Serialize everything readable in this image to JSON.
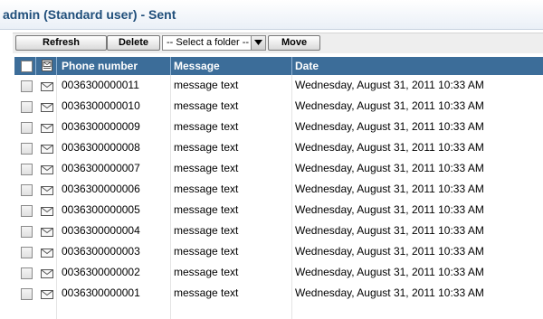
{
  "window": {
    "title": "admin (Standard user) - Sent"
  },
  "toolbar": {
    "refresh_label": "Refresh",
    "delete_label": "Delete",
    "folder_select_value": "-- Select a folder --",
    "move_label": "Move"
  },
  "table": {
    "columns": [
      "Phone number",
      "Message",
      "Date"
    ],
    "rows": [
      {
        "phone": "0036300000011",
        "message": "message text",
        "date": "Wednesday, August 31, 2011 10:33 AM"
      },
      {
        "phone": "0036300000010",
        "message": "message text",
        "date": "Wednesday, August 31, 2011 10:33 AM"
      },
      {
        "phone": "0036300000009",
        "message": "message text",
        "date": "Wednesday, August 31, 2011 10:33 AM"
      },
      {
        "phone": "0036300000008",
        "message": "message text",
        "date": "Wednesday, August 31, 2011 10:33 AM"
      },
      {
        "phone": "0036300000007",
        "message": "message text",
        "date": "Wednesday, August 31, 2011 10:33 AM"
      },
      {
        "phone": "0036300000006",
        "message": "message text",
        "date": "Wednesday, August 31, 2011 10:33 AM"
      },
      {
        "phone": "0036300000005",
        "message": "message text",
        "date": "Wednesday, August 31, 2011 10:33 AM"
      },
      {
        "phone": "0036300000004",
        "message": "message text",
        "date": "Wednesday, August 31, 2011 10:33 AM"
      },
      {
        "phone": "0036300000003",
        "message": "message text",
        "date": "Wednesday, August 31, 2011 10:33 AM"
      },
      {
        "phone": "0036300000002",
        "message": "message text",
        "date": "Wednesday, August 31, 2011 10:33 AM"
      },
      {
        "phone": "0036300000001",
        "message": "message text",
        "date": "Wednesday, August 31, 2011 10:33 AM"
      }
    ]
  },
  "icons": {
    "header_type": "message-type-icon",
    "row_type": "envelope-icon",
    "select_arrow": "chevron-down-icon"
  },
  "colors": {
    "title_text": "#1f4e7a",
    "header_background": "#3c6d99",
    "header_text": "#ffffff"
  }
}
